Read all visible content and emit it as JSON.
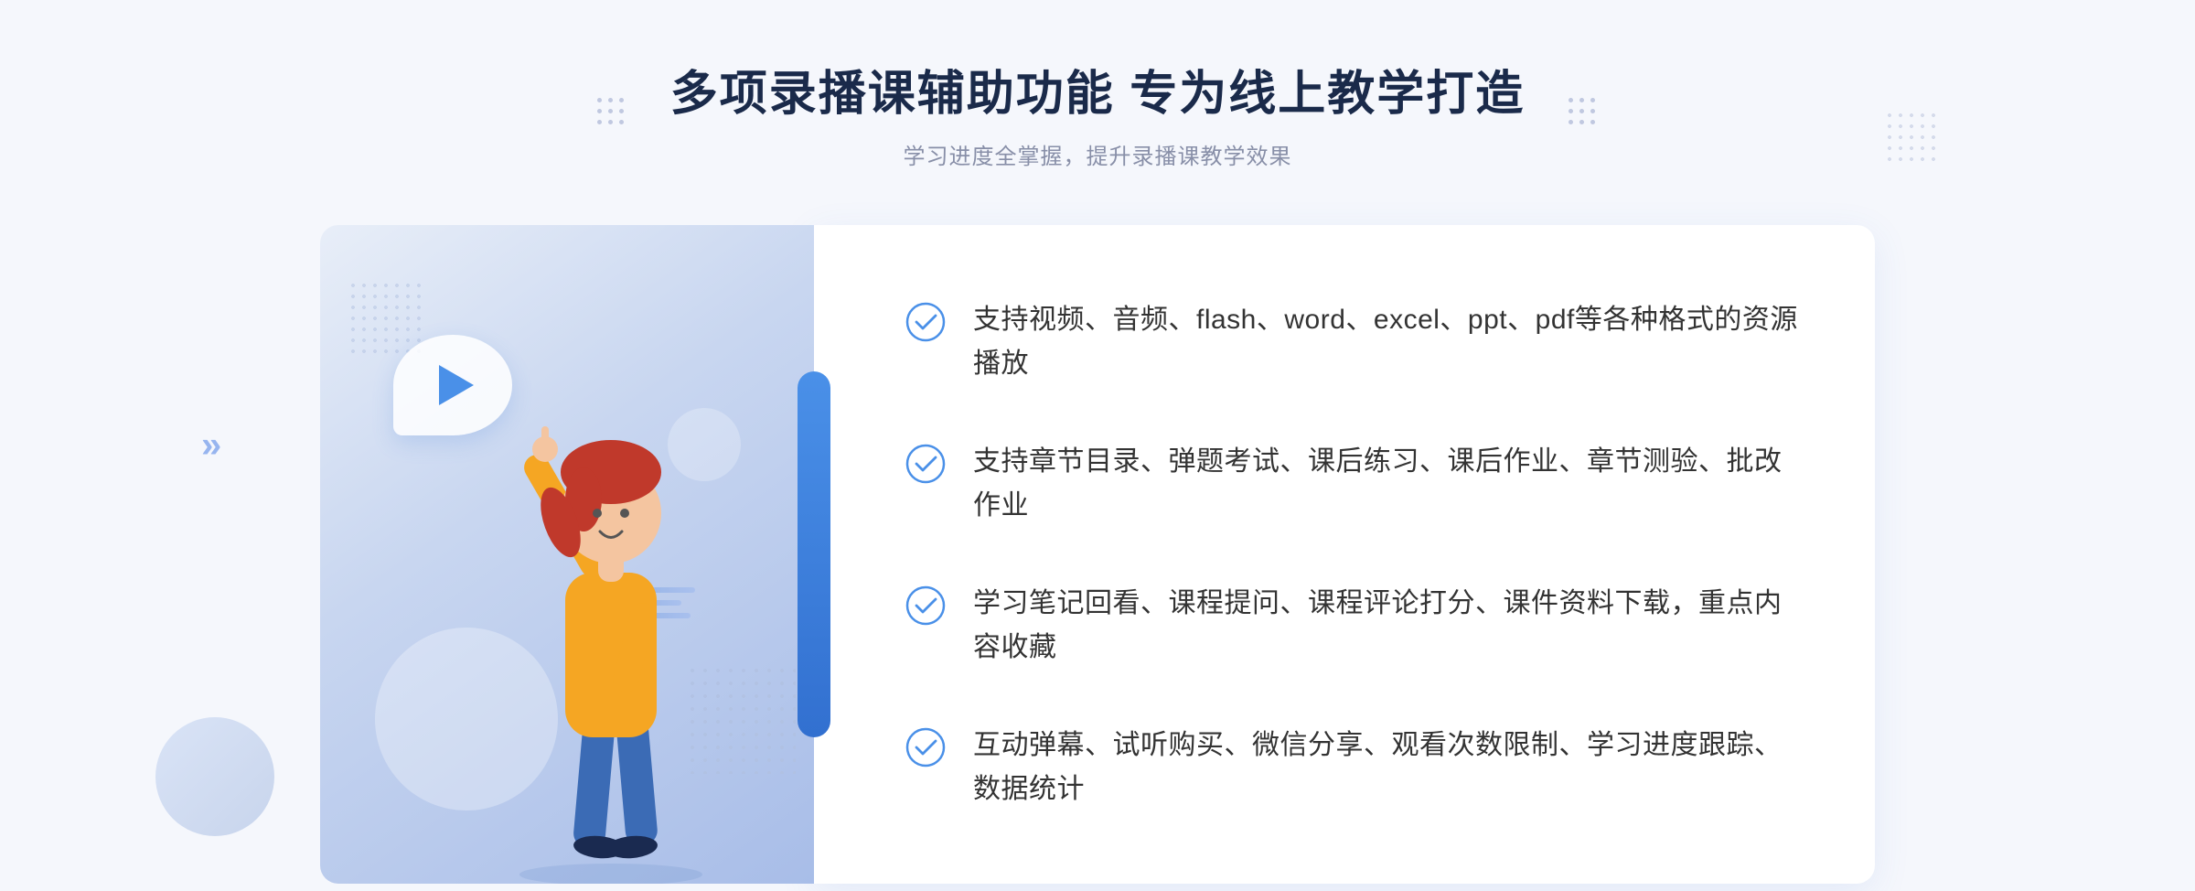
{
  "header": {
    "title": "多项录播课辅助功能 专为线上教学打造",
    "subtitle": "学习进度全掌握，提升录播课教学效果"
  },
  "features": [
    {
      "id": "feature-1",
      "text": "支持视频、音频、flash、word、excel、ppt、pdf等各种格式的资源播放"
    },
    {
      "id": "feature-2",
      "text": "支持章节目录、弹题考试、课后练习、课后作业、章节测验、批改作业"
    },
    {
      "id": "feature-3",
      "text": "学习笔记回看、课程提问、课程评论打分、课件资料下载，重点内容收藏"
    },
    {
      "id": "feature-4",
      "text": "互动弹幕、试听购买、微信分享、观看次数限制、学习进度跟踪、数据统计"
    }
  ],
  "colors": {
    "primary_blue": "#4a90e8",
    "dark_blue": "#3270d0",
    "title_color": "#1a2a4a",
    "text_color": "#333333",
    "subtitle_color": "#888fa8",
    "bg_color": "#f5f7fc",
    "check_color": "#4a90e8"
  }
}
